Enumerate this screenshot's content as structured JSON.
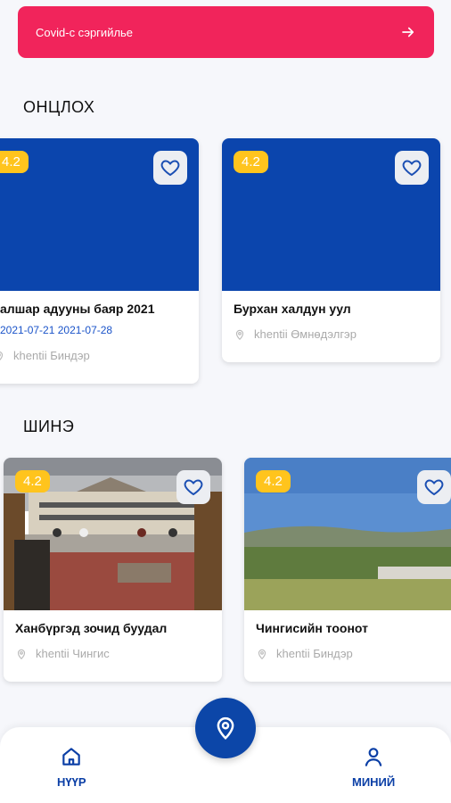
{
  "banner": {
    "text": "Covid-с сэргийлье",
    "icon": "arrow-right-icon"
  },
  "sections": {
    "popular_title": "ОНЦЛОХ",
    "new_title": "ШИНЭ"
  },
  "popular": [
    {
      "rating": "4.2",
      "title": "алшар адууны баяр 2021",
      "date": "2021-07-21 2021-07-28",
      "location": "khentii Биндэр"
    },
    {
      "rating": "4.2",
      "title": "Бурхан халдун уул",
      "location": "khentii Өмнөдэлгэр"
    }
  ],
  "new": [
    {
      "rating": "4.2",
      "title": "Ханбүргэд зочид буудал",
      "location": "khentii Чингис"
    },
    {
      "rating": "4.2",
      "title": "Чингисийн тоонот",
      "location": "khentii Биндэр"
    }
  ],
  "nav": {
    "home_label": "НҮҮР",
    "profile_label": "МИНИЙ"
  },
  "colors": {
    "accent": "#0b45ad",
    "banner": "#f1245b",
    "rating": "#ffc41d"
  }
}
